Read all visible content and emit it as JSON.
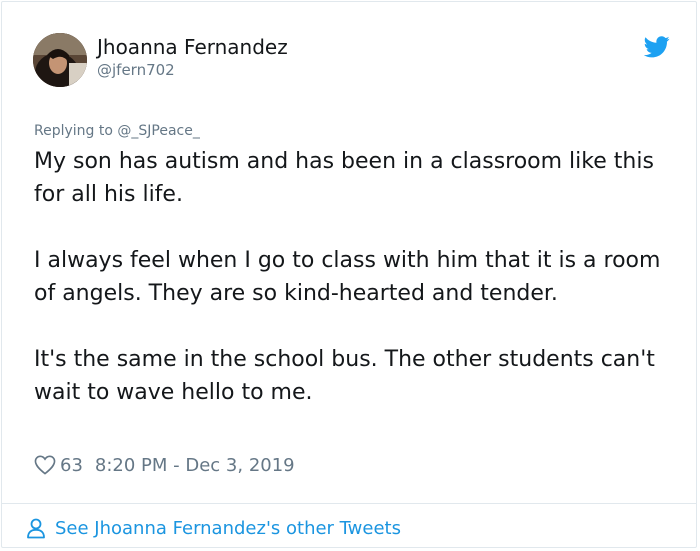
{
  "author": {
    "display_name": "Jhoanna Fernandez",
    "handle": "@jfern702",
    "avatar_icon": "profile-photo"
  },
  "brand": {
    "icon": "twitter-bird-icon",
    "color": "#1da1f2"
  },
  "reply": {
    "prefix": "Replying to",
    "mention": "@_SJPeace_"
  },
  "tweet": {
    "paragraphs": [
      "My son has autism and has been in a classroom like this for all his life.",
      "I always feel when I go to class with him that it is a room of angels.  They are so kind-hearted and tender.",
      "It's the same in the school bus.  The other students can't wait to wave hello to me."
    ]
  },
  "meta": {
    "like_icon": "heart-icon",
    "like_count": "63",
    "timestamp": "8:20 PM - Dec 3, 2019"
  },
  "footer": {
    "icon": "person-icon",
    "link_text": "See Jhoanna Fernandez's other Tweets",
    "link_color": "#1b95e0"
  },
  "colors": {
    "text_primary": "#14171a",
    "text_secondary": "#657786",
    "border": "#e1e8ed"
  }
}
